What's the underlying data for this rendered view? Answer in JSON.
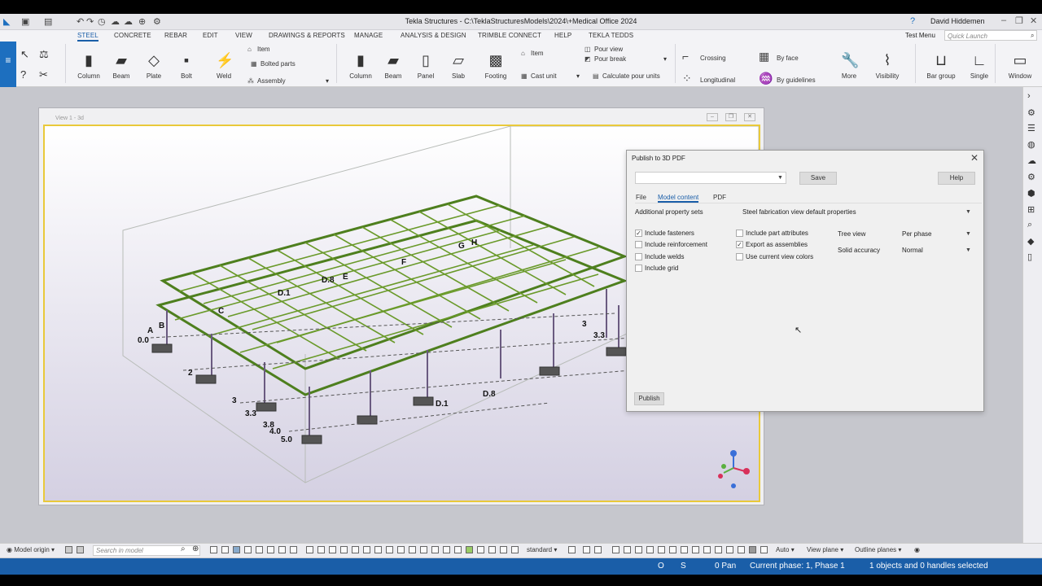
{
  "window": {
    "title": "Tekla Structures - C:\\TeklaStructuresModels\\2024\\+Medical Office 2024",
    "user": "David Hiddemen"
  },
  "tabs": [
    "STEEL",
    "CONCRETE",
    "REBAR",
    "EDIT",
    "VIEW",
    "DRAWINGS & REPORTS",
    "MANAGE",
    "ANALYSIS & DESIGN",
    "TRIMBLE CONNECT",
    "HELP",
    "TEKLA TEDDS"
  ],
  "active_tab": "STEEL",
  "test_menu": "Test Menu",
  "quick_launch_placeholder": "Quick Launch",
  "ribbon": {
    "steel": {
      "column": "Column",
      "beam": "Beam",
      "plate": "Plate",
      "bolt": "Bolt",
      "weld": "Weld",
      "item": "Item",
      "bolted_parts": "Bolted parts",
      "assembly": "Assembly"
    },
    "concrete": {
      "column": "Column",
      "beam": "Beam",
      "panel": "Panel",
      "slab": "Slab",
      "footing": "Footing",
      "item": "Item",
      "cast_unit": "Cast unit",
      "pour_view": "Pour view",
      "pour_break": "Pour break",
      "calculate": "Calculate pour units"
    },
    "rebar": {
      "crossing": "Crossing",
      "longitudinal": "Longitudinal",
      "by_face": "By face",
      "by_guidelines": "By guidelines",
      "more": "More",
      "visibility": "Visibility",
      "bar_group": "Bar group",
      "single": "Single"
    },
    "window": "Window"
  },
  "view": {
    "title": "View 1 - 3d"
  },
  "dialog": {
    "title": "Publish to 3D PDF",
    "save": "Save",
    "help": "Help",
    "tabs": [
      "File",
      "Model content",
      "PDF"
    ],
    "active_tab": "Model content",
    "additional_label": "Additional property sets",
    "additional_value": "Steel fabrication view default properties",
    "options_left": [
      {
        "label": "Include fasteners",
        "checked": true
      },
      {
        "label": "Include reinforcement",
        "checked": false
      },
      {
        "label": "Include welds",
        "checked": false
      },
      {
        "label": "Include grid",
        "checked": false
      }
    ],
    "options_mid": [
      {
        "label": "Include part attributes",
        "checked": false
      },
      {
        "label": "Export as assemblies",
        "checked": true
      },
      {
        "label": "Use current view colors",
        "checked": false
      }
    ],
    "tree_view_label": "Tree view",
    "tree_view_value": "Per phase",
    "solid_accuracy_label": "Solid accuracy",
    "solid_accuracy_value": "Normal",
    "publish": "Publish"
  },
  "statusbar": {
    "model_origin": "Model origin",
    "search_placeholder": "Search in model",
    "standard": "standard",
    "auto": "Auto",
    "view_plane": "View plane",
    "outline_planes": "Outline planes",
    "o": "O",
    "s": "S",
    "pan": "0 Pan",
    "phase": "Current phase: 1, Phase 1",
    "selection": "1 objects and 0 handles selected"
  },
  "grid_labels": [
    "A",
    "B",
    "C",
    "D.1",
    "D.8",
    "E",
    "F",
    "G",
    "H",
    "0.0",
    "2",
    "3",
    "3.3",
    "3.8",
    "4.0",
    "5.0"
  ],
  "colors": {
    "accent": "#1a5ea8",
    "steel_green": "#4e7f1e",
    "view_border": "#e9c93a"
  }
}
